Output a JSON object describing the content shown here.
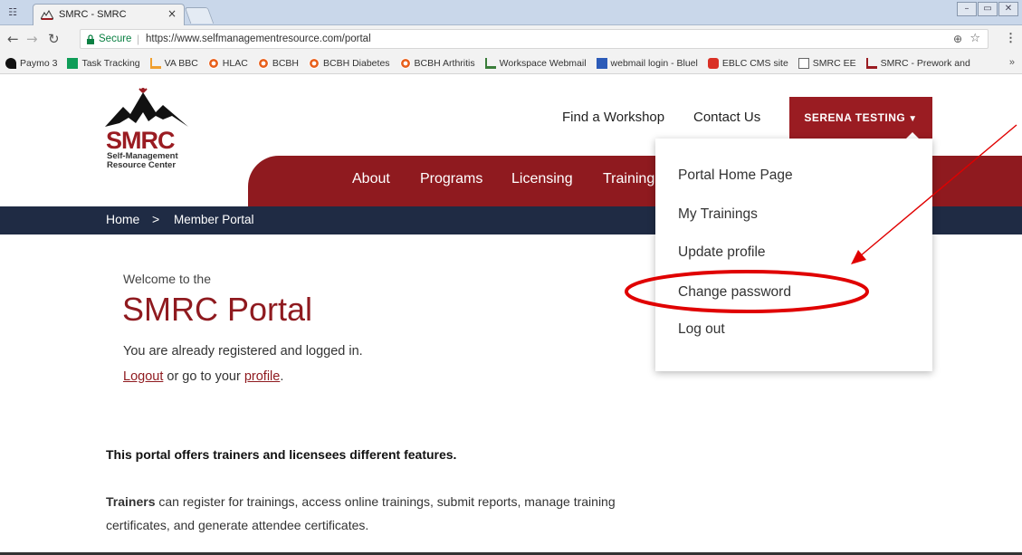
{
  "browser": {
    "tab_title": "SMRC - SMRC",
    "tab_close": "×",
    "secure_label": "Secure",
    "url_separator": "|",
    "url": "https://www.selfmanagementresource.com/portal",
    "bookmarks": [
      {
        "label": "Paymo 3",
        "icon": "paymo-icon",
        "color": "#111111"
      },
      {
        "label": "Task Tracking",
        "icon": "sheets-icon",
        "color": "#0f9d58"
      },
      {
        "label": "VA BBC",
        "icon": "leaf-icon",
        "color": "#f0a030"
      },
      {
        "label": "HLAC",
        "icon": "target-icon",
        "color": "#e8601c"
      },
      {
        "label": "BCBH",
        "icon": "target-icon",
        "color": "#e8601c"
      },
      {
        "label": "BCBH Diabetes",
        "icon": "target-icon",
        "color": "#e8601c"
      },
      {
        "label": "BCBH Arthritis",
        "icon": "target-icon",
        "color": "#e8601c"
      },
      {
        "label": "Workspace Webmail",
        "icon": "workspace-icon",
        "color": "#3a7d3a"
      },
      {
        "label": "webmail login - Bluel",
        "icon": "grid-icon",
        "color": "#2c5bb8"
      },
      {
        "label": "EBLC CMS site",
        "icon": "chat-icon",
        "color": "#d93025"
      },
      {
        "label": "SMRC EE",
        "icon": "page-icon",
        "color": "#666666"
      },
      {
        "label": "SMRC - Prework and",
        "icon": "smrc-icon",
        "color": "#9a1c22"
      }
    ],
    "bookmarks_more": "»"
  },
  "site": {
    "logo_text": "SMRC",
    "logo_sub_line1": "Self-Management",
    "logo_sub_line2": "Resource Center",
    "util_links": {
      "find_workshop": "Find a Workshop",
      "contact_us": "Contact Us"
    },
    "user_button": "SERENA TESTING",
    "nav": {
      "about": "About",
      "programs": "Programs",
      "licensing": "Licensing",
      "trainings": "Training"
    },
    "breadcrumb": {
      "home": "Home",
      "separator": ">",
      "current": "Member Portal"
    }
  },
  "main": {
    "welcome": "Welcome to the",
    "title": "SMRC Portal",
    "registered": "You are already registered and logged in.",
    "logout_link": "Logout",
    "middle_text": " or go to your ",
    "profile_link": "profile",
    "period": ".",
    "features_heading": "This portal offers trainers and licensees different features.",
    "trainers_bold": "Trainers",
    "trainers_text": " can register for trainings, access online trainings, submit reports, manage training certificates, and generate attendee certificates."
  },
  "dropdown": {
    "items": [
      "Portal Home Page",
      "My Trainings",
      "Update profile",
      "Change password",
      "Log out"
    ],
    "highlighted_index": 3
  },
  "colors": {
    "brand_red": "#8f1a1f",
    "navy": "#1f2b44",
    "annotation_red": "#e00000"
  }
}
